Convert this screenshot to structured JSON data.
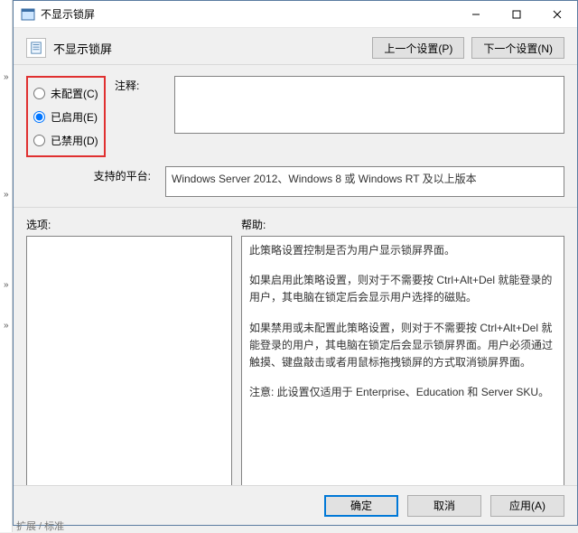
{
  "titlebar": {
    "title": "不显示锁屏"
  },
  "page": {
    "heading": "不显示锁屏"
  },
  "nav": {
    "prev_label": "上一个设置(P)",
    "next_label": "下一个设置(N)"
  },
  "config": {
    "radio": {
      "not_configured": "未配置(C)",
      "enabled": "已启用(E)",
      "disabled": "已禁用(D)",
      "selected": "enabled"
    },
    "comment_label": "注释:",
    "comment_value": "",
    "supported_label": "支持的平台:",
    "supported_value": "Windows Server 2012、Windows 8 或 Windows RT 及以上版本"
  },
  "sections": {
    "options_label": "选项:",
    "help_label": "帮助:"
  },
  "help_text": {
    "p1": "此策略设置控制是否为用户显示锁屏界面。",
    "p2": "如果启用此策略设置，则对于不需要按 Ctrl+Alt+Del 就能登录的用户，其电脑在锁定后会显示用户选择的磁贴。",
    "p3": "如果禁用或未配置此策略设置，则对于不需要按 Ctrl+Alt+Del 就能登录的用户，其电脑在锁定后会显示锁屏界面。用户必须通过触摸、键盘敲击或者用鼠标拖拽锁屏的方式取消锁屏界面。",
    "p4": "注意: 此设置仅适用于 Enterprise、Education 和 Server SKU。"
  },
  "footer": {
    "ok": "确定",
    "cancel": "取消",
    "apply": "应用(A)"
  },
  "background_hint": "扩展 / 标准"
}
